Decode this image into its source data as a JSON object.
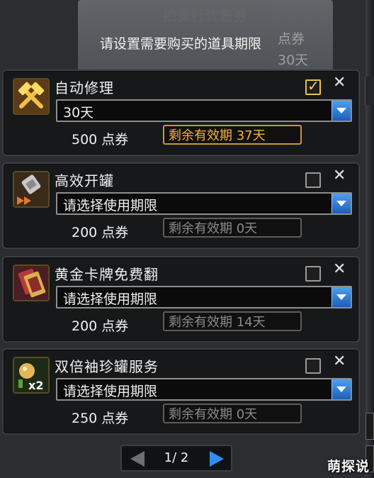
{
  "background_window": {
    "title": "拍卖行优惠券",
    "side_text": "点券"
  },
  "instruction": "请设置需要购买的道具期限",
  "items": [
    {
      "name": "自动修理",
      "icon": "hammer-icon",
      "checked": true,
      "select_value": "30天",
      "price": "500 点券",
      "remaining": "剩余有效期 37天"
    },
    {
      "name": "高效开罐",
      "icon": "drill-icon",
      "checked": false,
      "select_value": "请选择使用期限",
      "price": "200 点券",
      "remaining": "剩余有效期 0天"
    },
    {
      "name": "黄金卡牌免费翻",
      "icon": "card-icon",
      "checked": false,
      "select_value": "请选择使用期限",
      "price": "200 点券",
      "remaining": "剩余有效期 14天"
    },
    {
      "name": "双倍袖珍罐服务",
      "icon": "double-jar-icon",
      "checked": false,
      "select_value": "请选择使用期限",
      "price": "250 点券",
      "remaining": "剩余有效期 0天"
    }
  ],
  "pager": {
    "text": "1/ 2"
  },
  "watermark": "萌探说",
  "colors": {
    "accent_blue": "#2f8ff0",
    "gold": "#f3b23b",
    "panel": "#16181a"
  }
}
